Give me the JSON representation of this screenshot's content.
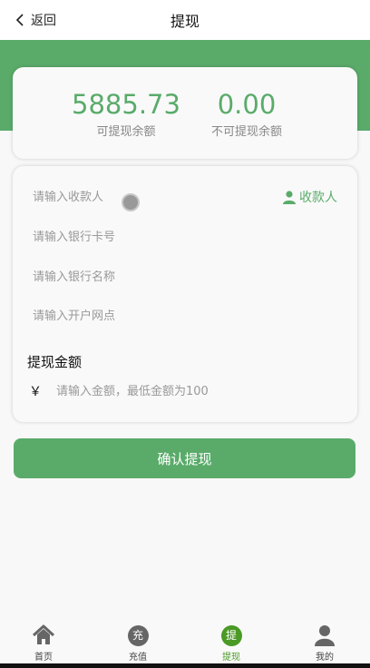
{
  "header": {
    "back_label": "返回",
    "title": "提现"
  },
  "balance": {
    "available_value": "5885.73",
    "available_label": "可提现余额",
    "unavailable_value": "0.00",
    "unavailable_label": "不可提现余额"
  },
  "form": {
    "payee_placeholder": "请输入收款人",
    "payee_link_label": "收款人",
    "card_placeholder": "请输入银行卡号",
    "bank_placeholder": "请输入银行名称",
    "branch_placeholder": "请输入开户网点",
    "amount_title": "提现金额",
    "currency_symbol": "￥",
    "amount_placeholder": "请输入金额，最低金额为100"
  },
  "confirm_label": "确认提现",
  "tabs": [
    {
      "label": "首页",
      "icon": "home-icon"
    },
    {
      "label": "充值",
      "icon": "recharge-icon",
      "glyph": "充"
    },
    {
      "label": "提现",
      "icon": "withdraw-icon",
      "glyph": "提",
      "active": true
    },
    {
      "label": "我的",
      "icon": "user-icon"
    }
  ],
  "colors": {
    "accent": "#5aab6a",
    "active_tab": "#4a9a25"
  }
}
